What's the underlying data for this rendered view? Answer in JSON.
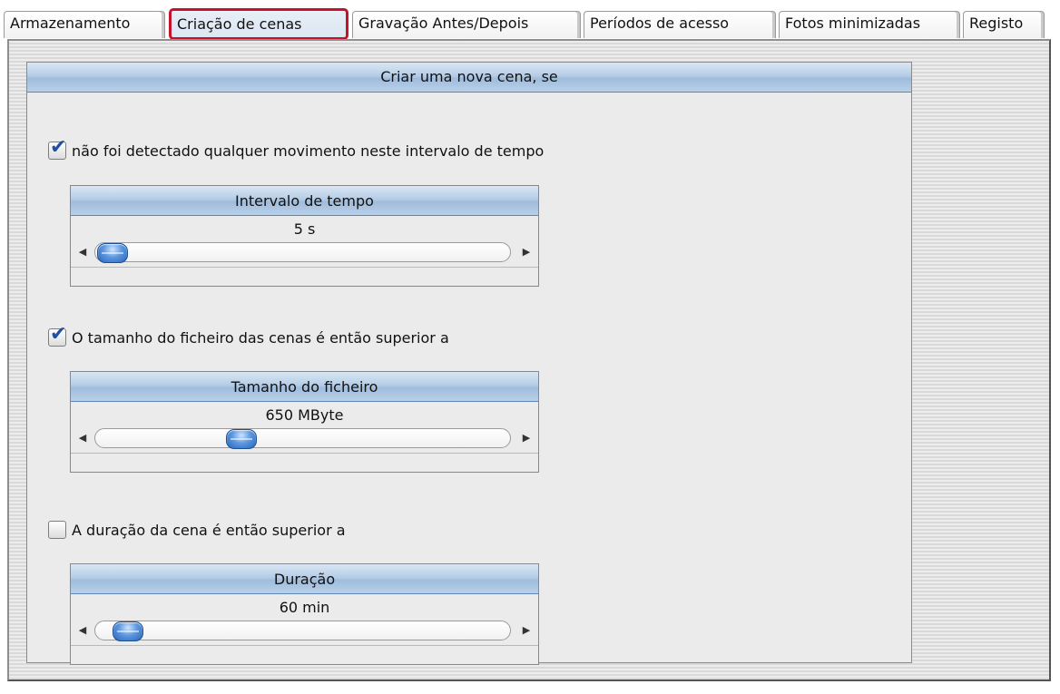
{
  "tabs": [
    {
      "label": "Armazenamento",
      "active": false
    },
    {
      "label": "Criação de cenas",
      "active": true
    },
    {
      "label": "Gravação Antes/Depois",
      "active": false
    },
    {
      "label": "Períodos de acesso",
      "active": false
    },
    {
      "label": "Fotos minimizadas",
      "active": false
    },
    {
      "label": "Registo",
      "active": false
    }
  ],
  "panel": {
    "title": "Criar uma nova cena, se"
  },
  "conditions": [
    {
      "label": "não foi detectado qualquer movimento neste intervalo de tempo",
      "checked": true,
      "box_title": "Intervalo de tempo",
      "value": "5 s",
      "slider_fraction": 0.0
    },
    {
      "label": "O tamanho do ficheiro das cenas é então superior a",
      "checked": true,
      "box_title": "Tamanho do ficheiro",
      "value": "650 MByte",
      "slider_fraction": 0.34
    },
    {
      "label": "A duração da cena é então superior a",
      "checked": false,
      "box_title": "Duração",
      "value": "60 min",
      "slider_fraction": 0.04
    }
  ],
  "colors": {
    "active_tab_outline": "#c4142d",
    "header_blue": "#b6cde6",
    "checkmark": "#1f4fa0",
    "slider_thumb": "#2b64b8"
  }
}
